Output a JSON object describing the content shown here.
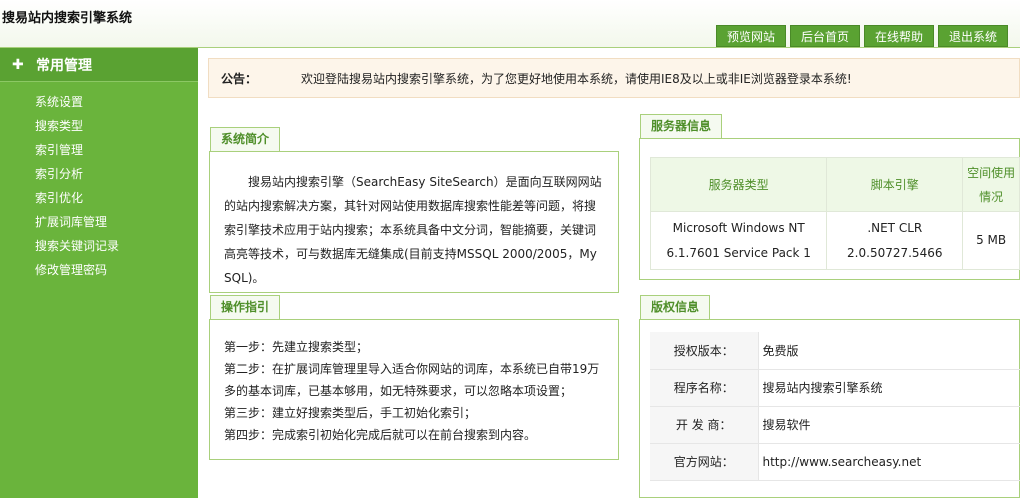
{
  "header": {
    "title": "搜易站内搜索引擎系统",
    "nav": [
      "预览网站",
      "后台首页",
      "在线帮助",
      "退出系统"
    ]
  },
  "sidebar": {
    "title": "常用管理",
    "items": [
      "系统设置",
      "搜索类型",
      "索引管理",
      "索引分析",
      "索引优化",
      "扩展词库管理",
      "搜索关键词记录",
      "修改管理密码"
    ]
  },
  "notice": {
    "label": "公告：",
    "text": "欢迎登陆搜易站内搜索引擎系统，为了您更好地使用本系统，请使用IE8及以上或非IE浏览器登录本系统!"
  },
  "intro": {
    "title": "系统简介",
    "text": "搜易站内搜索引擎（SearchEasy SiteSearch）是面向互联网网站的站内搜索解决方案，其针对网站使用数据库搜索性能差等问题，将搜索引擎技术应用于站内搜索；本系统具备中文分词，智能摘要，关键词高亮等技术，可与数据库无缝集成(目前支持MSSQL 2000/2005，My SQL)。"
  },
  "guide": {
    "title": "操作指引",
    "steps": [
      "第一步：先建立搜索类型；",
      "第二步：在扩展词库管理里导入适合你网站的词库，本系统已自带19万多的基本词库，已基本够用，如无特殊要求，可以忽略本项设置；",
      "第三步：建立好搜索类型后，手工初始化索引；",
      "第四步：完成索引初始化完成后就可以在前台搜索到内容。"
    ]
  },
  "server": {
    "title": "服务器信息",
    "headers": [
      "服务器类型",
      "脚本引擎",
      "空间使用情况"
    ],
    "row": [
      "Microsoft Windows NT 6.1.7601 Service Pack 1",
      ".NET CLR 2.0.50727.5466",
      "5 MB"
    ]
  },
  "copyright": {
    "title": "版权信息",
    "rows": [
      {
        "key": "授权版本：",
        "value": "免费版"
      },
      {
        "key": "程序名称：",
        "value": "搜易站内搜索引擎系统"
      },
      {
        "key": "开 发 商：",
        "value": "搜易软件"
      },
      {
        "key": "官方网站：",
        "value": "http://www.searcheasy.net"
      }
    ]
  },
  "colors": {
    "accent": "#6ab43c",
    "nav_button": "#5aa232",
    "border": "#a9d07c"
  }
}
